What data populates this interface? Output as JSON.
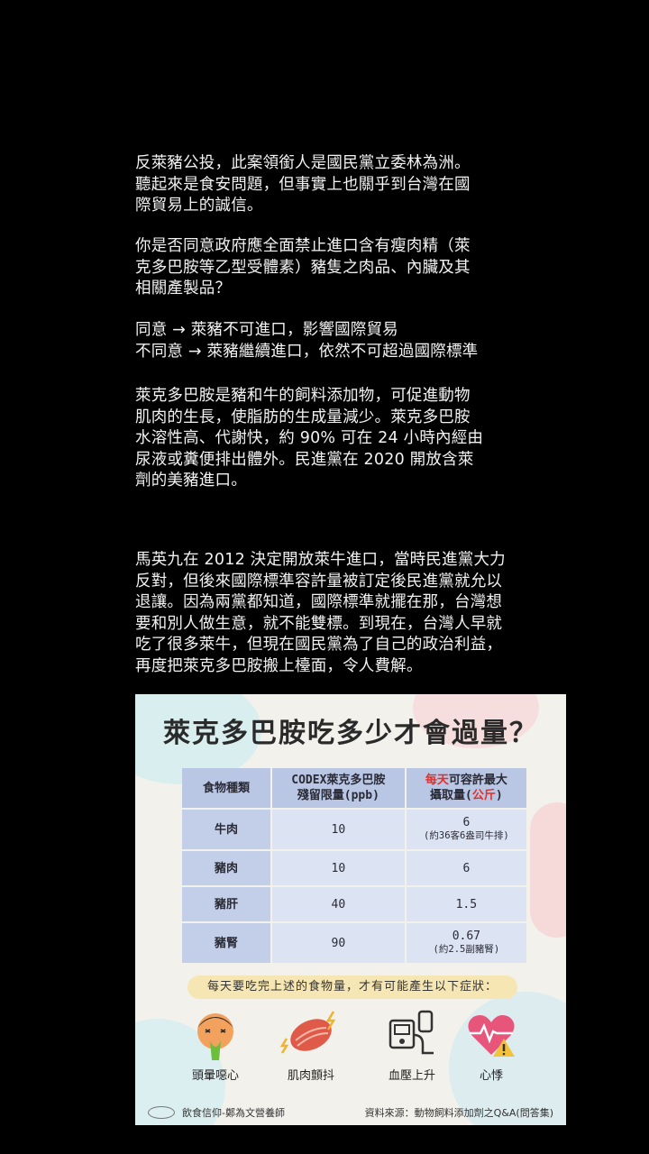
{
  "paragraphs": {
    "p1": [
      "反萊豬公投，此案領銜人是國民黨立委林為洲。",
      "聽起來是食安問題，但事實上也關乎到台灣在國",
      "際貿易上的誠信。"
    ],
    "p2": [
      "你是否同意政府應全面禁止進口含有瘦肉精（萊",
      "克多巴胺等乙型受體素）豬隻之肉品、內臟及其",
      "相關產製品？"
    ],
    "p3": [
      "同意 → 萊豬不可進口，影響國際貿易",
      "不同意 → 萊豬繼續進口，依然不可超過國際標準"
    ],
    "p4": [
      "萊克多巴胺是豬和牛的飼料添加物，可促進動物",
      "肌肉的生長，使脂肪的生成量減少。萊克多巴胺",
      "水溶性高、代謝快，約 90% 可在 24 小時內經由",
      "尿液或糞便排出體外。民進黨在 2020 開放含萊",
      "劑的美豬進口。"
    ],
    "p5": [
      "馬英九在 2012 決定開放萊牛進口，當時民進黨大力",
      "反對，但後來國際標準容許量被訂定後民進黨就允以",
      "退讓。因為兩黨都知道，國際標準就擺在那，台灣想",
      "要和別人做生意，就不能雙標。到現在，台灣人早就",
      "吃了很多萊牛，但現在國民黨為了自己的政治利益，",
      "再度把萊克多巴胺搬上檯面，令人費解。"
    ]
  },
  "infographic": {
    "title": "萊克多巴胺吃多少才會過量？",
    "headers": {
      "food": "食物種類",
      "codex_line1": "CODEX萊克多巴胺",
      "codex_line2": "殘留限量(ppb)",
      "max_red": "每天",
      "max_rest": "可容許最大",
      "max_line2_a": "攝取量(",
      "max_line2_red": "公斤",
      "max_line2_b": ")"
    },
    "rows": [
      {
        "food": "牛肉",
        "ppb": "10",
        "max": "6",
        "note": "(約36客6盎司牛排)"
      },
      {
        "food": "豬肉",
        "ppb": "10",
        "max": "6",
        "note": ""
      },
      {
        "food": "豬肝",
        "ppb": "40",
        "max": "1.5",
        "note": ""
      },
      {
        "food": "豬腎",
        "ppb": "90",
        "max": "0.67",
        "note": "(約2.5副豬腎)"
      }
    ],
    "notice": "每天要吃完上述的食物量，才有可能產生以下症狀：",
    "symptoms": [
      "頭暈噁心",
      "肌肉顫抖",
      "血壓上升",
      "心悸"
    ],
    "footer_left": "飲食信仰-鄭為文營養師",
    "footer_right": "資料來源：動物飼料添加劑之Q&A(問答集)",
    "colors": {
      "header_bg": "#b9c6e4",
      "cell_bg": "#dce4f4",
      "accent_red": "#e0302a",
      "notice_bg": "#f6e6b3"
    }
  }
}
